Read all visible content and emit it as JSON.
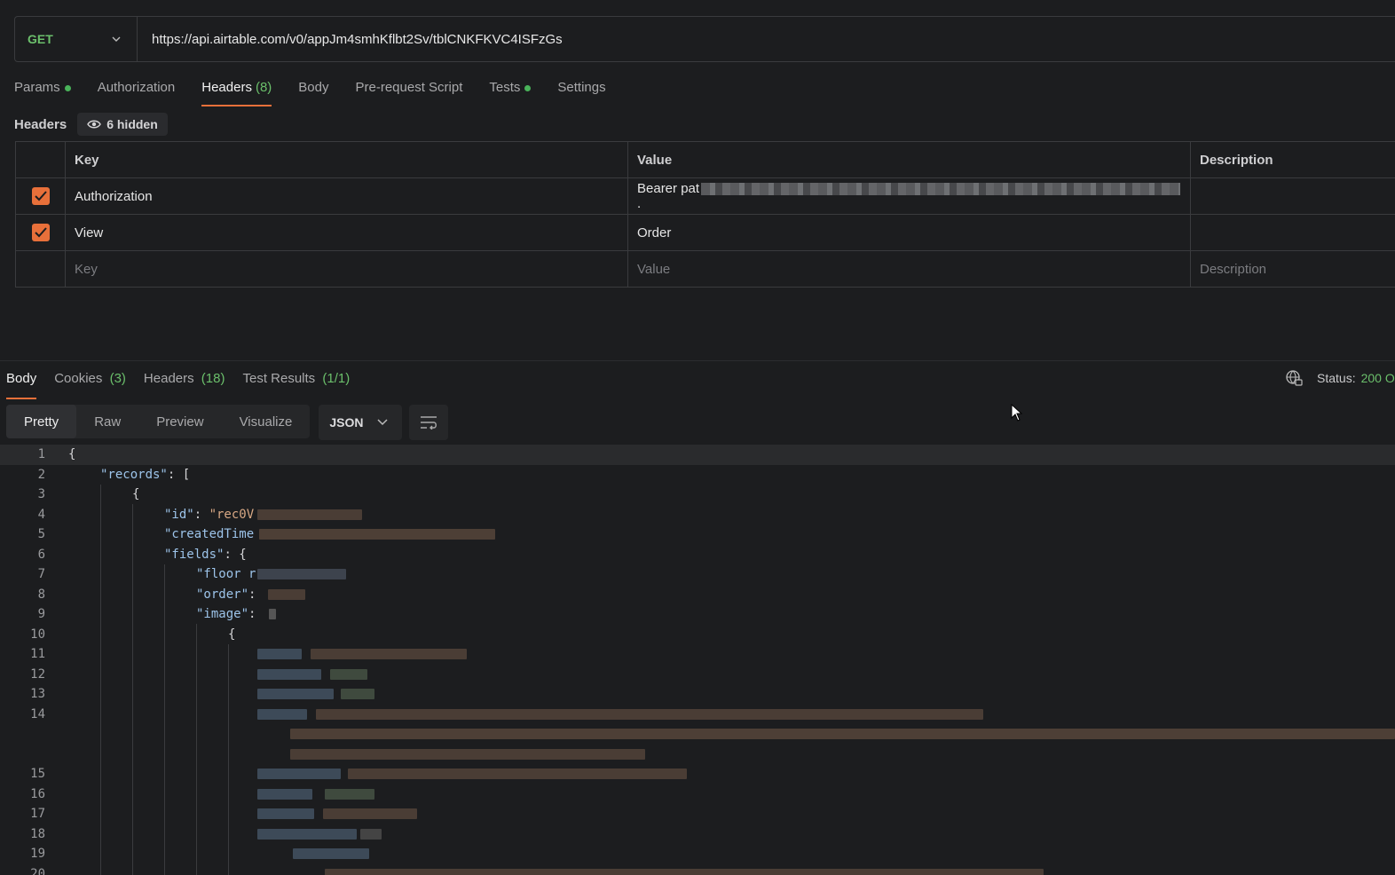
{
  "request": {
    "method": "GET",
    "url": "https://api.airtable.com/v0/appJm4smhKflbt2Sv/tblCNKFKVC4ISFzGs"
  },
  "request_tabs": [
    {
      "label": "Params",
      "dot": true
    },
    {
      "label": "Authorization"
    },
    {
      "label": "Headers",
      "count": "(8)",
      "active": true
    },
    {
      "label": "Body"
    },
    {
      "label": "Pre-request Script"
    },
    {
      "label": "Tests",
      "dot": true
    },
    {
      "label": "Settings"
    }
  ],
  "headers_section": {
    "title": "Headers",
    "hidden_label": "6 hidden",
    "columns": {
      "key": "Key",
      "value": "Value",
      "description": "Description"
    },
    "rows": [
      {
        "checked": true,
        "key": "Authorization",
        "value": "Bearer pat",
        "value_tail": "."
      },
      {
        "checked": true,
        "key": "View",
        "value": "Order"
      }
    ],
    "placeholders": {
      "key": "Key",
      "value": "Value",
      "description": "Description"
    }
  },
  "response_tabs": [
    {
      "label": "Body",
      "active": true
    },
    {
      "label": "Cookies",
      "count": "(3)"
    },
    {
      "label": "Headers",
      "count": "(18)"
    },
    {
      "label": "Test Results",
      "count": "(1/1)"
    }
  ],
  "status": {
    "label": "Status:",
    "code": "200 O"
  },
  "view_modes": [
    "Pretty",
    "Raw",
    "Preview",
    "Visualize"
  ],
  "active_view": "Pretty",
  "format": "JSON",
  "code": {
    "line_numbers": [
      "1",
      "2",
      "3",
      "4",
      "5",
      "6",
      "7",
      "8",
      "9",
      "10",
      "11",
      "12",
      "13",
      "14",
      "15",
      "16",
      "17",
      "18",
      "19",
      "20"
    ],
    "l1": "{",
    "l2_key": "\"records\"",
    "l2_rest": ": [",
    "l3": "{",
    "l4_key": "\"id\"",
    "l4_sep": ": ",
    "l4_val": "\"rec0V",
    "l5_key": "\"createdTime",
    "l6_key": "\"fields\"",
    "l6_rest": ": {",
    "l7_key": "\"floor r",
    "l8_key": "\"order\"",
    "l8_rest": ":",
    "l9_key": "\"image\"",
    "l9_rest": ":",
    "l10": "{"
  },
  "colors": {
    "accent": "#e8703a",
    "success": "#6bbf6b",
    "json_key": "#9dc4ea",
    "json_string": "#d8a884"
  }
}
